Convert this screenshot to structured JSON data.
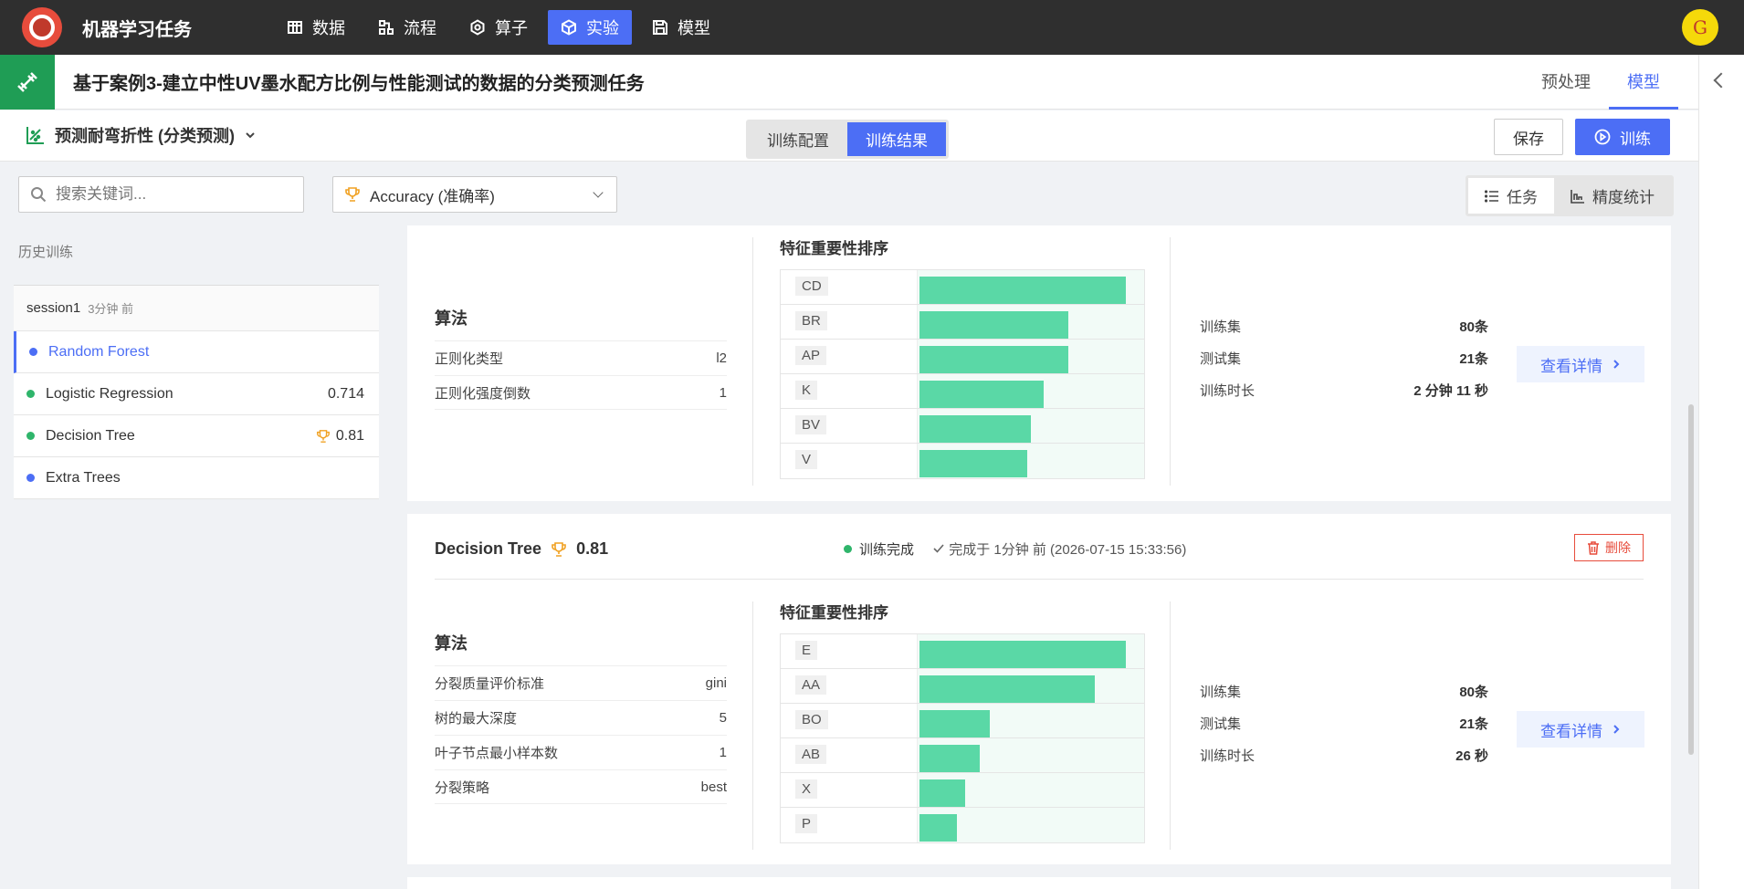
{
  "app": {
    "title": "机器学习任务",
    "user_initial": "G"
  },
  "nav": [
    {
      "label": "数据",
      "icon": "table-icon",
      "active": false
    },
    {
      "label": "流程",
      "icon": "flow-icon",
      "active": false
    },
    {
      "label": "算子",
      "icon": "operator-icon",
      "active": false
    },
    {
      "label": "实验",
      "icon": "cube-icon",
      "active": true
    },
    {
      "label": "模型",
      "icon": "save-icon",
      "active": false
    }
  ],
  "task": {
    "title": "基于案例3-建立中性UV墨水配方比例与性能测试的数据的分类预测任务"
  },
  "top_tabs": [
    {
      "label": "预处理",
      "active": false
    },
    {
      "label": "模型",
      "active": true
    }
  ],
  "model_select": {
    "label": "预测耐弯折性 (分类预测)"
  },
  "segment": [
    {
      "label": "训练配置",
      "active": false
    },
    {
      "label": "训练结果",
      "active": true
    }
  ],
  "buttons": {
    "save": "保存",
    "train": "训练"
  },
  "search": {
    "placeholder": "搜索关键词..."
  },
  "metric": {
    "label": "Accuracy (准确率)"
  },
  "view_toggle": [
    {
      "label": "任务",
      "active": true
    },
    {
      "label": "精度统计",
      "active": false
    }
  ],
  "history": {
    "title": "历史训练",
    "session": {
      "name": "session1",
      "ago": "3分钟 前"
    },
    "items": [
      {
        "name": "Random Forest",
        "score": "",
        "dot": "#4c6ef5",
        "active": true,
        "trophy": false
      },
      {
        "name": "Logistic Regression",
        "score": "0.714",
        "dot": "#2fb56b",
        "active": false,
        "trophy": false
      },
      {
        "name": "Decision Tree",
        "score": "0.81",
        "dot": "#2fb56b",
        "active": false,
        "trophy": true
      },
      {
        "name": "Extra Trees",
        "score": "",
        "dot": "#4c6ef5",
        "active": false,
        "trophy": false
      }
    ]
  },
  "cards": [
    {
      "algo_title": "算法",
      "params": [
        {
          "k": "正则化类型",
          "v": "l2"
        },
        {
          "k": "正则化强度倒数",
          "v": "1"
        }
      ],
      "fi_title": "特征重要性排序",
      "features": [
        {
          "name": "CD",
          "value": 1.0
        },
        {
          "name": "BR",
          "value": 0.72
        },
        {
          "name": "AP",
          "value": 0.72
        },
        {
          "name": "K",
          "value": 0.6
        },
        {
          "name": "BV",
          "value": 0.54
        },
        {
          "name": "V",
          "value": 0.52
        }
      ],
      "stats": [
        {
          "k": "训练集",
          "v": "80条"
        },
        {
          "k": "测试集",
          "v": "21条"
        },
        {
          "k": "训练时长",
          "v": "2 分钟 11 秒"
        }
      ],
      "details": "查看详情"
    },
    {
      "name": "Decision Tree",
      "score": "0.81",
      "status": "训练完成",
      "completed": "完成于 1分钟 前 (2026-07-15 15:33:56)",
      "delete": "删除",
      "algo_title": "算法",
      "params": [
        {
          "k": "分裂质量评价标准",
          "v": "gini"
        },
        {
          "k": "树的最大深度",
          "v": "5"
        },
        {
          "k": "叶子节点最小样本数",
          "v": "1"
        },
        {
          "k": "分裂策略",
          "v": "best"
        }
      ],
      "fi_title": "特征重要性排序",
      "features": [
        {
          "name": "E",
          "value": 1.0
        },
        {
          "name": "AA",
          "value": 0.85
        },
        {
          "name": "BO",
          "value": 0.34
        },
        {
          "name": "AB",
          "value": 0.29
        },
        {
          "name": "X",
          "value": 0.22
        },
        {
          "name": "P",
          "value": 0.18
        }
      ],
      "stats": [
        {
          "k": "训练集",
          "v": "80条"
        },
        {
          "k": "测试集",
          "v": "21条"
        },
        {
          "k": "训练时长",
          "v": "26 秒"
        }
      ],
      "details": "查看详情"
    }
  ],
  "colors": {
    "accent": "#4c6ef5",
    "success": "#2fb56b",
    "bar": "#5ad8a6",
    "danger": "#e74c3c",
    "nav_bg": "#2f2f2f"
  }
}
